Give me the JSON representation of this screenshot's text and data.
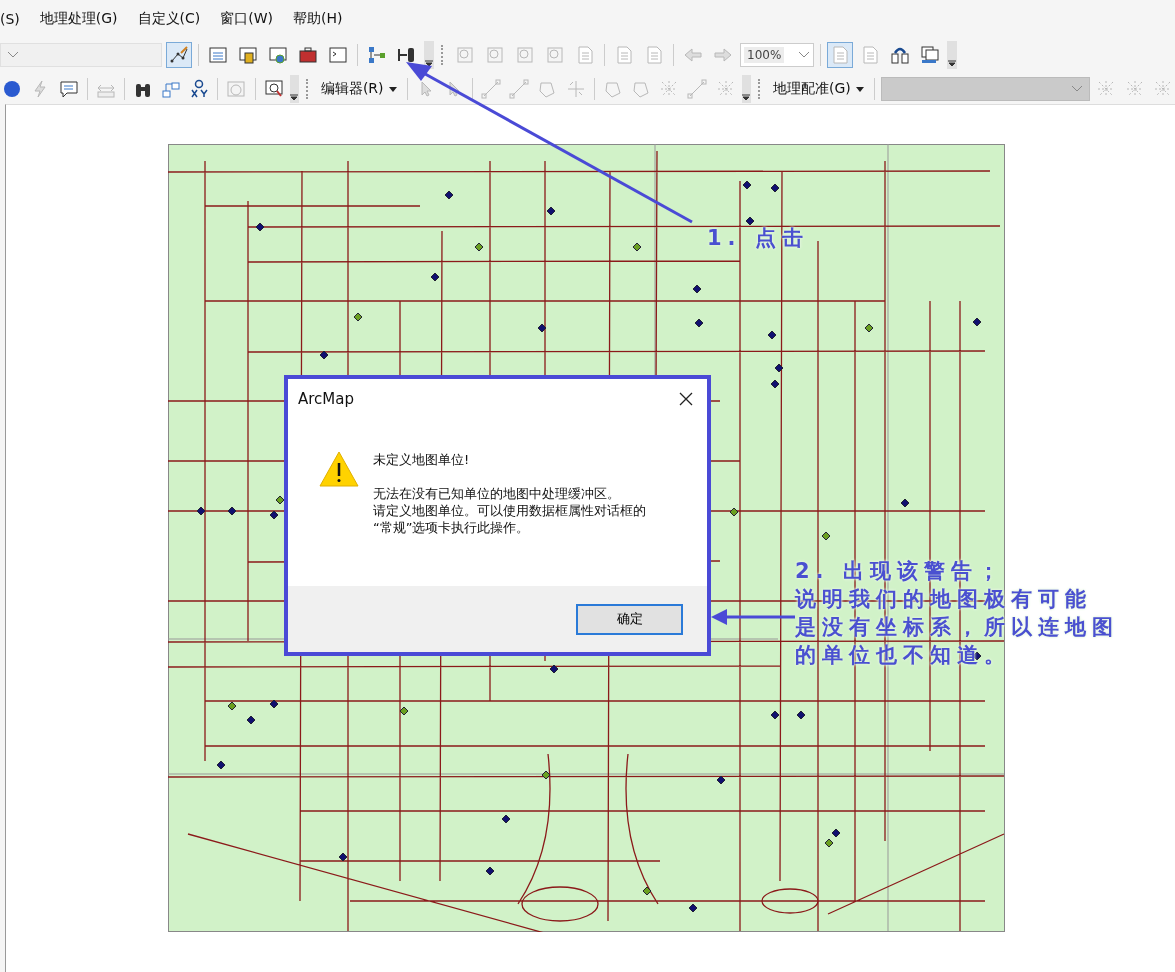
{
  "menu": [
    {
      "label": "(S)"
    },
    {
      "label": "地理处理(G)"
    },
    {
      "label": "自定义(C)"
    },
    {
      "label": "窗口(W)"
    },
    {
      "label": "帮助(H)"
    }
  ],
  "toolbar": {
    "zoom_value": "100%",
    "editor_menu": "编辑器(R)",
    "georeferencing_menu": "地理配准(G)"
  },
  "dialog": {
    "title": "ArcMap",
    "heading": "未定义地图单位!",
    "message": [
      "无法在没有已知单位的地图中处理缓冲区。",
      "请定义地图单位。可以使用数据框属性对话框的",
      "“常规”选项卡执行此操作。"
    ],
    "button": "确定"
  },
  "annotations": [
    {
      "lines": [
        "1. 点击"
      ]
    },
    {
      "lines": [
        "2. 出现该警告；",
        "说明我们的地图极有可能",
        "是没有坐标系，所以连地图",
        "的单位也不知道。"
      ]
    }
  ]
}
